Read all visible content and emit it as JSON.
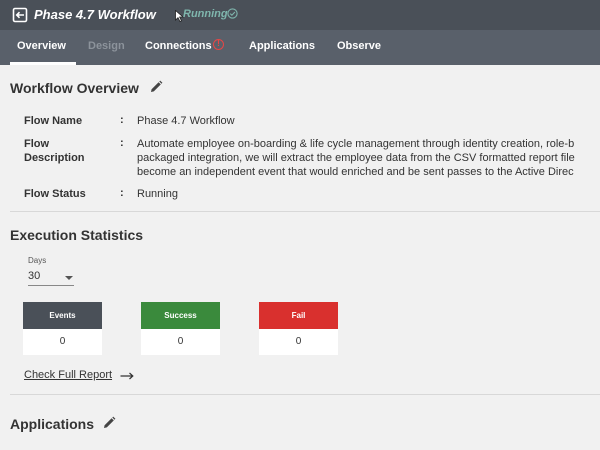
{
  "header": {
    "title": "Phase 4.7 Workflow",
    "status": "Running",
    "back_icon": "back-exit-icon",
    "status_icon": "check-circle-icon"
  },
  "tabs": [
    {
      "label": "Overview",
      "state": "active"
    },
    {
      "label": "Design",
      "state": "disabled"
    },
    {
      "label": "Connections",
      "state": "alert"
    },
    {
      "label": "Applications",
      "state": "normal"
    },
    {
      "label": "Observe",
      "state": "normal"
    }
  ],
  "overview": {
    "title": "Workflow Overview",
    "fields": [
      {
        "key": "Flow Name",
        "value": "Phase 4.7 Workflow"
      },
      {
        "key_line1": "Flow",
        "key_line2": "Description",
        "lines": [
          "Automate employee on-boarding & life cycle management through identity creation, role-b",
          "packaged integration, we will extract the employee data from the CSV formatted report file",
          "become an independent event that would enriched and be sent passes to the Active Direc"
        ]
      },
      {
        "key": "Flow Status",
        "value": "Running"
      }
    ],
    "separator": ":"
  },
  "stats": {
    "title": "Execution Statistics",
    "days_label": "Days",
    "days_value": "30",
    "cards": [
      {
        "label": "Events",
        "value": "0",
        "color": "#4a5058"
      },
      {
        "label": "Success",
        "value": "0",
        "color": "#3a8a3c"
      },
      {
        "label": "Fail",
        "value": "0",
        "color": "#d9302e"
      }
    ],
    "report_link": "Check Full Report"
  },
  "applications": {
    "title": "Applications"
  }
}
